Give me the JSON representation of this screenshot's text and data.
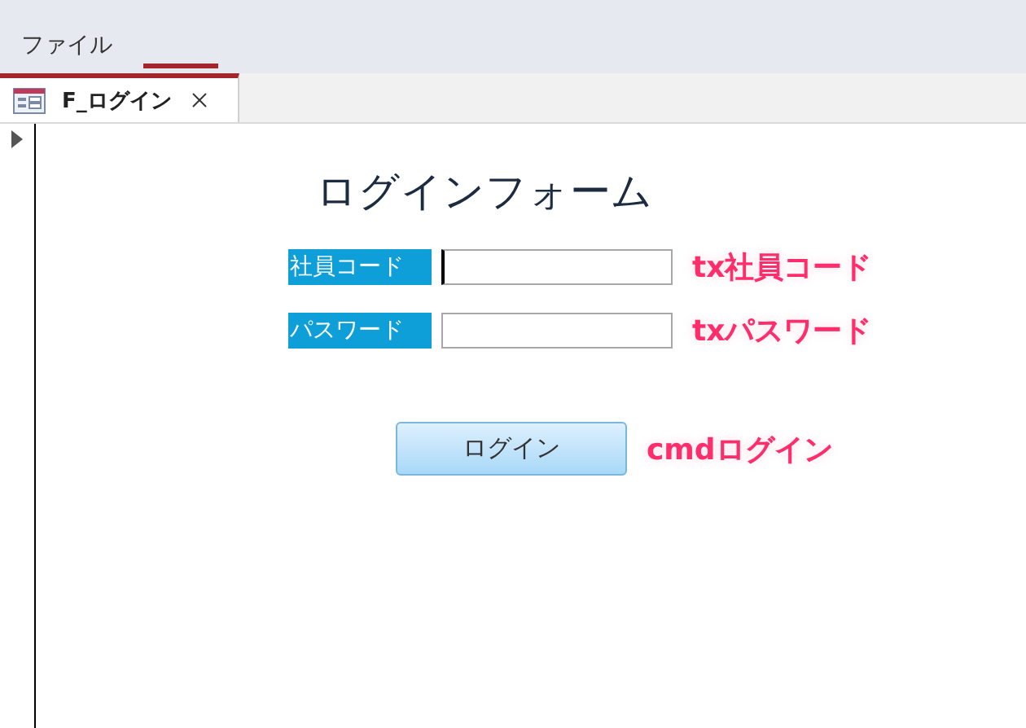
{
  "menu": [
    {
      "label": "ファイル"
    }
  ],
  "document_tab": {
    "label": "F_ログイン"
  },
  "form": {
    "title": "ログインフォーム",
    "fields": [
      {
        "label": "社員コード",
        "focused": true,
        "annotation": "tx社員コード"
      },
      {
        "label": "パスワード",
        "focused": false,
        "annotation": "txパスワード"
      }
    ],
    "button": {
      "label": "ログイン",
      "annotation": "cmdログイン"
    }
  }
}
